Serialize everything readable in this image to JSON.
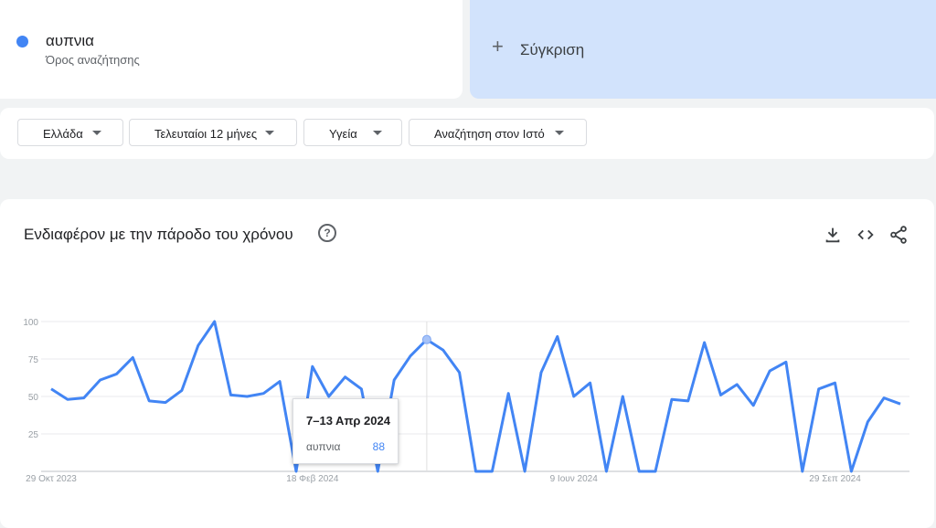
{
  "term": {
    "name": "αυπνια",
    "subtitle": "Όρος αναζήτησης",
    "color": "#4285f4"
  },
  "compare": {
    "plus": "+",
    "label": "Σύγκριση"
  },
  "filters": [
    {
      "label": "Ελλάδα"
    },
    {
      "label": "Τελευταίοι 12 μήνες"
    },
    {
      "label": "Υγεία"
    },
    {
      "label": "Αναζήτηση στον Ιστό"
    }
  ],
  "chart_header": {
    "title": "Ενδιαφέρον με την πάροδο του χρόνου",
    "help": "?"
  },
  "icons": {
    "help": "help-icon",
    "download": "download-icon",
    "embed": "embed-code-icon",
    "share": "share-icon"
  },
  "tooltip": {
    "date": "7–13 Απρ 2024",
    "term": "αυπνια",
    "value": "88"
  },
  "chart_data": {
    "type": "line",
    "title": "Ενδιαφέρον με την πάροδο του χρόνου",
    "x_tick_labels": [
      "29 Οκτ 2023",
      "18 Φεβ 2024",
      "9 Ιουν 2024",
      "29 Σεπ 2024"
    ],
    "x_tick_indices": [
      0,
      16,
      32,
      48
    ],
    "y_ticks": [
      25,
      50,
      75,
      100
    ],
    "ylim": [
      0,
      100
    ],
    "grid": true,
    "highlight_index": 23,
    "series": [
      {
        "name": "αυπνια",
        "color": "#4285f4",
        "values": [
          55,
          48,
          49,
          61,
          65,
          76,
          47,
          46,
          54,
          84,
          100,
          51,
          50,
          52,
          60,
          0,
          70,
          50,
          63,
          55,
          0,
          61,
          77,
          88,
          81,
          66,
          0,
          0,
          52,
          0,
          66,
          90,
          50,
          59,
          0,
          50,
          0,
          0,
          48,
          47,
          86,
          51,
          58,
          44,
          67,
          73,
          0,
          55,
          59,
          0,
          33,
          49,
          45
        ]
      }
    ]
  }
}
